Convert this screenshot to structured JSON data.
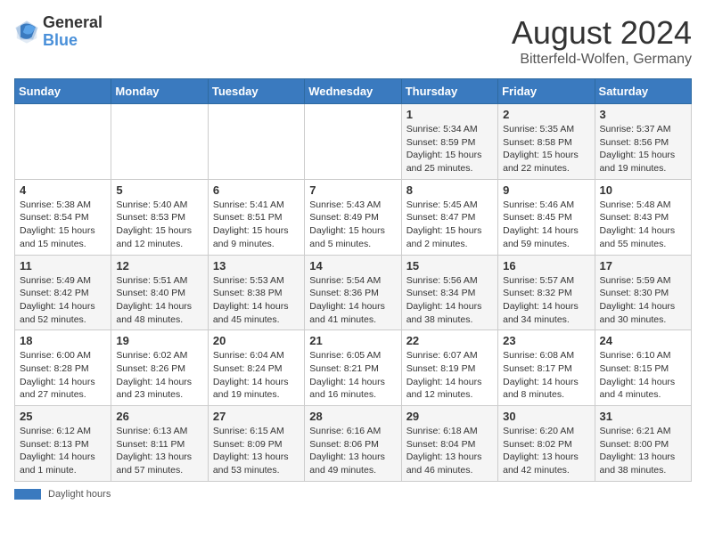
{
  "header": {
    "logo_general": "General",
    "logo_blue": "Blue",
    "title": "August 2024",
    "subtitle": "Bitterfeld-Wolfen, Germany"
  },
  "calendar": {
    "days_of_week": [
      "Sunday",
      "Monday",
      "Tuesday",
      "Wednesday",
      "Thursday",
      "Friday",
      "Saturday"
    ],
    "weeks": [
      [
        {
          "day": "",
          "info": ""
        },
        {
          "day": "",
          "info": ""
        },
        {
          "day": "",
          "info": ""
        },
        {
          "day": "",
          "info": ""
        },
        {
          "day": "1",
          "info": "Sunrise: 5:34 AM\nSunset: 8:59 PM\nDaylight: 15 hours\nand 25 minutes."
        },
        {
          "day": "2",
          "info": "Sunrise: 5:35 AM\nSunset: 8:58 PM\nDaylight: 15 hours\nand 22 minutes."
        },
        {
          "day": "3",
          "info": "Sunrise: 5:37 AM\nSunset: 8:56 PM\nDaylight: 15 hours\nand 19 minutes."
        }
      ],
      [
        {
          "day": "4",
          "info": "Sunrise: 5:38 AM\nSunset: 8:54 PM\nDaylight: 15 hours\nand 15 minutes."
        },
        {
          "day": "5",
          "info": "Sunrise: 5:40 AM\nSunset: 8:53 PM\nDaylight: 15 hours\nand 12 minutes."
        },
        {
          "day": "6",
          "info": "Sunrise: 5:41 AM\nSunset: 8:51 PM\nDaylight: 15 hours\nand 9 minutes."
        },
        {
          "day": "7",
          "info": "Sunrise: 5:43 AM\nSunset: 8:49 PM\nDaylight: 15 hours\nand 5 minutes."
        },
        {
          "day": "8",
          "info": "Sunrise: 5:45 AM\nSunset: 8:47 PM\nDaylight: 15 hours\nand 2 minutes."
        },
        {
          "day": "9",
          "info": "Sunrise: 5:46 AM\nSunset: 8:45 PM\nDaylight: 14 hours\nand 59 minutes."
        },
        {
          "day": "10",
          "info": "Sunrise: 5:48 AM\nSunset: 8:43 PM\nDaylight: 14 hours\nand 55 minutes."
        }
      ],
      [
        {
          "day": "11",
          "info": "Sunrise: 5:49 AM\nSunset: 8:42 PM\nDaylight: 14 hours\nand 52 minutes."
        },
        {
          "day": "12",
          "info": "Sunrise: 5:51 AM\nSunset: 8:40 PM\nDaylight: 14 hours\nand 48 minutes."
        },
        {
          "day": "13",
          "info": "Sunrise: 5:53 AM\nSunset: 8:38 PM\nDaylight: 14 hours\nand 45 minutes."
        },
        {
          "day": "14",
          "info": "Sunrise: 5:54 AM\nSunset: 8:36 PM\nDaylight: 14 hours\nand 41 minutes."
        },
        {
          "day": "15",
          "info": "Sunrise: 5:56 AM\nSunset: 8:34 PM\nDaylight: 14 hours\nand 38 minutes."
        },
        {
          "day": "16",
          "info": "Sunrise: 5:57 AM\nSunset: 8:32 PM\nDaylight: 14 hours\nand 34 minutes."
        },
        {
          "day": "17",
          "info": "Sunrise: 5:59 AM\nSunset: 8:30 PM\nDaylight: 14 hours\nand 30 minutes."
        }
      ],
      [
        {
          "day": "18",
          "info": "Sunrise: 6:00 AM\nSunset: 8:28 PM\nDaylight: 14 hours\nand 27 minutes."
        },
        {
          "day": "19",
          "info": "Sunrise: 6:02 AM\nSunset: 8:26 PM\nDaylight: 14 hours\nand 23 minutes."
        },
        {
          "day": "20",
          "info": "Sunrise: 6:04 AM\nSunset: 8:24 PM\nDaylight: 14 hours\nand 19 minutes."
        },
        {
          "day": "21",
          "info": "Sunrise: 6:05 AM\nSunset: 8:21 PM\nDaylight: 14 hours\nand 16 minutes."
        },
        {
          "day": "22",
          "info": "Sunrise: 6:07 AM\nSunset: 8:19 PM\nDaylight: 14 hours\nand 12 minutes."
        },
        {
          "day": "23",
          "info": "Sunrise: 6:08 AM\nSunset: 8:17 PM\nDaylight: 14 hours\nand 8 minutes."
        },
        {
          "day": "24",
          "info": "Sunrise: 6:10 AM\nSunset: 8:15 PM\nDaylight: 14 hours\nand 4 minutes."
        }
      ],
      [
        {
          "day": "25",
          "info": "Sunrise: 6:12 AM\nSunset: 8:13 PM\nDaylight: 14 hours\nand 1 minute."
        },
        {
          "day": "26",
          "info": "Sunrise: 6:13 AM\nSunset: 8:11 PM\nDaylight: 13 hours\nand 57 minutes."
        },
        {
          "day": "27",
          "info": "Sunrise: 6:15 AM\nSunset: 8:09 PM\nDaylight: 13 hours\nand 53 minutes."
        },
        {
          "day": "28",
          "info": "Sunrise: 6:16 AM\nSunset: 8:06 PM\nDaylight: 13 hours\nand 49 minutes."
        },
        {
          "day": "29",
          "info": "Sunrise: 6:18 AM\nSunset: 8:04 PM\nDaylight: 13 hours\nand 46 minutes."
        },
        {
          "day": "30",
          "info": "Sunrise: 6:20 AM\nSunset: 8:02 PM\nDaylight: 13 hours\nand 42 minutes."
        },
        {
          "day": "31",
          "info": "Sunrise: 6:21 AM\nSunset: 8:00 PM\nDaylight: 13 hours\nand 38 minutes."
        }
      ]
    ]
  },
  "footer": {
    "daylight_label": "Daylight hours"
  }
}
